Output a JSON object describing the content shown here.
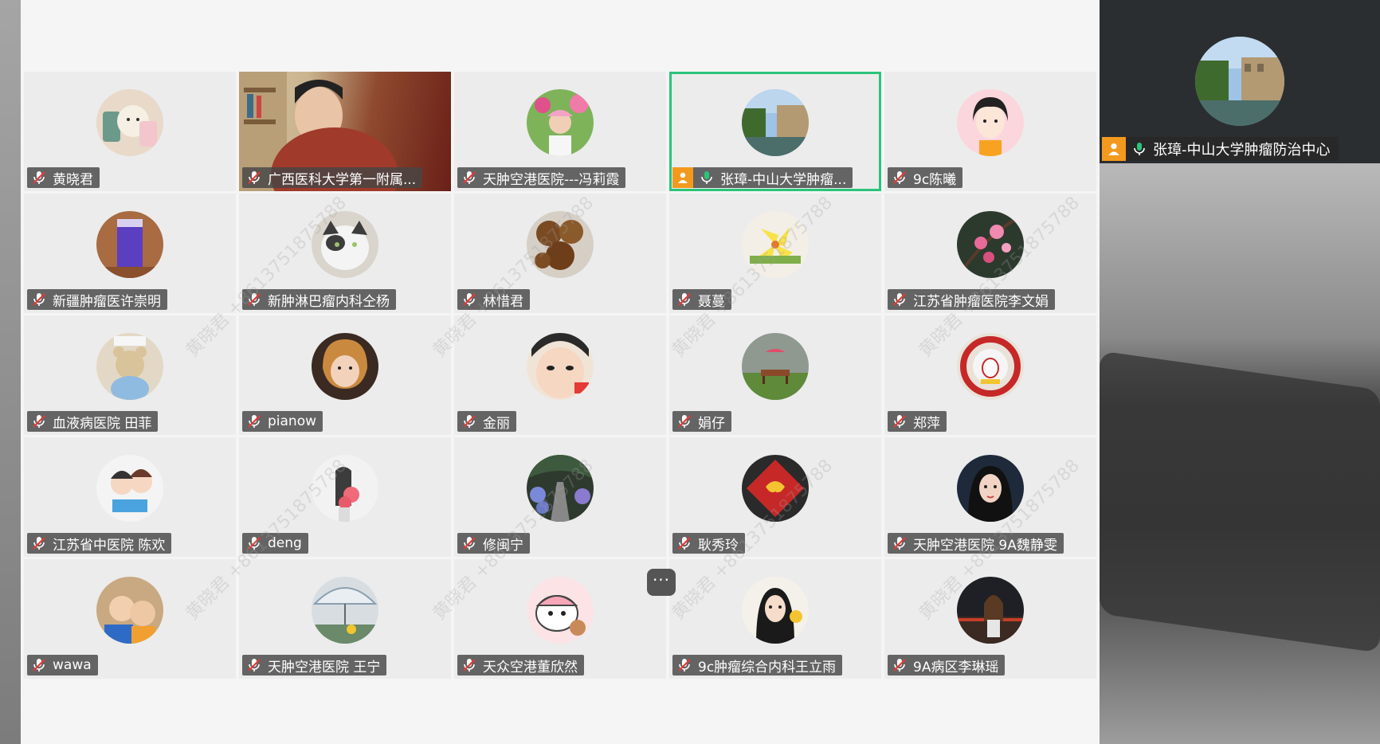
{
  "participants": [
    {
      "name": "黄晓君"
    },
    {
      "name": "广西医科大学第一附属..."
    },
    {
      "name": "天肿空港医院---冯莉霞"
    },
    {
      "name": "张璋-中山大学肿瘤..."
    },
    {
      "name": "9c陈曦"
    },
    {
      "name": "新疆肿瘤医许崇明"
    },
    {
      "name": "新肿淋巴瘤内科仝杨"
    },
    {
      "name": "林惜君"
    },
    {
      "name": "聂蔓"
    },
    {
      "name": "江苏省肿瘤医院李文娟"
    },
    {
      "name": "血液病医院  田菲"
    },
    {
      "name": "pianow"
    },
    {
      "name": "金丽"
    },
    {
      "name": "娟仔"
    },
    {
      "name": "郑萍"
    },
    {
      "name": "江苏省中医院 陈欢"
    },
    {
      "name": "deng"
    },
    {
      "name": "修闽宁"
    },
    {
      "name": "耿秀玲"
    },
    {
      "name": "天肿空港医院 9A魏静雯"
    },
    {
      "name": "wawa"
    },
    {
      "name": "天肿空港医院  王宁"
    },
    {
      "name": "天众空港董欣然"
    },
    {
      "name": "9c肿瘤综合内科王立雨"
    },
    {
      "name": "9A病区李琳瑶"
    }
  ],
  "active_speaker": {
    "name": "张璋-中山大学肿瘤防治中心"
  },
  "more_button": {
    "label": "···"
  },
  "watermark": {
    "text": "黄晓君 +8613751875788"
  },
  "colors": {
    "active_border": "#2ac47a",
    "host_badge": "#f39a1e",
    "tag_bg": "#464646"
  }
}
